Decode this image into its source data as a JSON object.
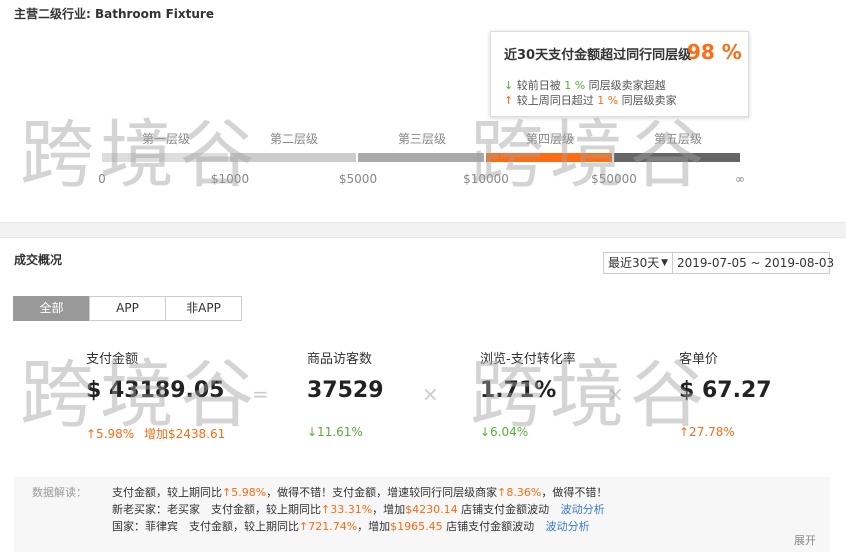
{
  "industry_title": "主营二级行业: Bathroom Fixture",
  "tooltip": {
    "headline": "近30天支付金额超过同行同层级",
    "percent": "98 %",
    "row1_arrow": "↓",
    "row1_pre": "较前日被",
    "row1_value": "1 %",
    "row1_post": "同层级卖家超越",
    "row2_arrow": "↑",
    "row2_pre": "较上周同日超过",
    "row2_value": "1 %",
    "row2_post": "同层级卖家"
  },
  "tiers": [
    {
      "label": "第一层级",
      "color": "#dddddd"
    },
    {
      "label": "第二层级",
      "color": "#cccccc"
    },
    {
      "label": "第三层级",
      "color": "#aaaaaa"
    },
    {
      "label": "第四层级",
      "color": "#ff6a13"
    },
    {
      "label": "第五层级",
      "color": "#666666"
    }
  ],
  "ticks": [
    "0",
    "$1000",
    "$5000",
    "$10000",
    "$50000",
    "∞"
  ],
  "section_title": "成交概况",
  "range_select": {
    "value": "最近30天",
    "caret": "▼"
  },
  "date_range": "2019-07-05 ~ 2019-08-03",
  "tabs": [
    {
      "label": "全部",
      "active": true
    },
    {
      "label": "APP",
      "active": false
    },
    {
      "label": "非APP",
      "active": false
    }
  ],
  "metrics": [
    {
      "label": "支付金额",
      "value": "$ 43189.05",
      "change": "↑5.98%",
      "extra": "增加$2438.61",
      "trend": "up"
    },
    {
      "label": "商品访客数",
      "value": "37529",
      "change": "↓11.61%",
      "extra": "",
      "trend": "down"
    },
    {
      "label": "浏览-支付转化率",
      "value": "1.71%",
      "change": "↓6.04%",
      "extra": "",
      "trend": "down"
    },
    {
      "label": "客单价",
      "value": "$ 67.27",
      "change": "↑27.78%",
      "extra": "",
      "trend": "up"
    }
  ],
  "operators": [
    "=",
    "×",
    "×"
  ],
  "interpretation": {
    "label": "数据解读：",
    "line1": {
      "a": "支付金额，较上期同比",
      "b": "↑5.98%",
      "c": "，做得不错！支付金额，增速较同行同层级商家",
      "d": "↑8.36%",
      "e": "，做得不错！"
    },
    "line2": {
      "a": "新老买家：老买家　支付金额，较上期同比",
      "b": "↑33.31%",
      "c": "，增加",
      "d": "$4230.14",
      "e": " 店铺支付金额波动",
      "link": "波动分析"
    },
    "line3": {
      "a": "国家：菲律宾　支付金额，较上期同比",
      "b": "↑721.74%",
      "c": "，增加",
      "d": "$1965.45",
      "e": " 店铺支付金额波动",
      "link": "波动分析"
    },
    "expand": "展开"
  },
  "watermark": "跨境谷",
  "colors": {
    "accent": "#ff6a13",
    "up": "#ff6a13",
    "down": "#55b135",
    "link": "#3b7bd5"
  }
}
